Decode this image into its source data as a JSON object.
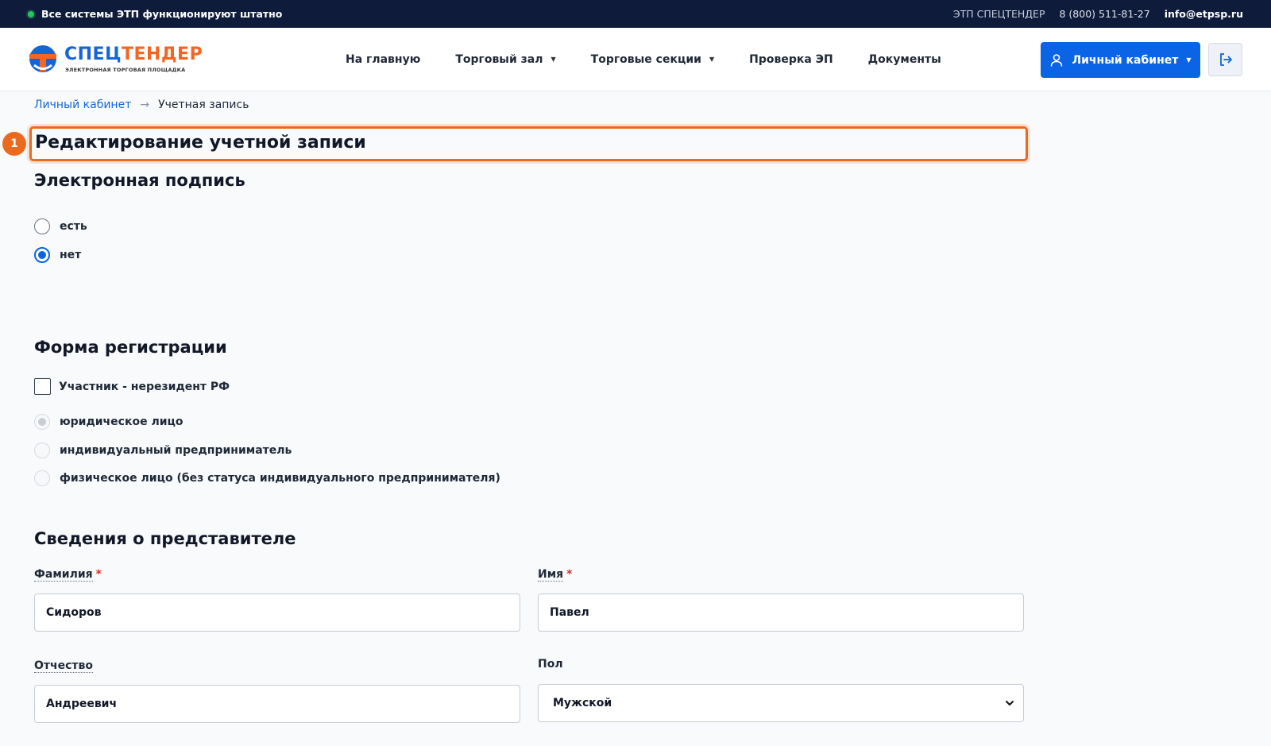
{
  "topbar": {
    "status": "Все системы ЭТП функционируют штатно",
    "platform": "ЭТП СПЕЦТЕНДЕР",
    "phone": "8 (800) 511-81-27",
    "email": "info@etpsp.ru"
  },
  "logo": {
    "part1": "СПЕЦ",
    "part2": "ТЕНДЕР",
    "tagline": "ЭЛЕКТРОННАЯ ТОРГОВАЯ ПЛОЩАДКА"
  },
  "nav": {
    "home": "На главную",
    "trading_hall": "Торговый зал",
    "trading_sections": "Торговые секции",
    "ep_check": "Проверка ЭП",
    "documents": "Документы"
  },
  "header": {
    "cabinet_label": "Личный кабинет"
  },
  "breadcrumb": {
    "root": "Личный кабинет",
    "arrow": "→",
    "current": "Учетная запись"
  },
  "page": {
    "badge": "1",
    "title": "Редактирование учетной записи"
  },
  "signature": {
    "heading": "Электронная подпись",
    "options": [
      "есть",
      "нет"
    ],
    "selected": "нет"
  },
  "registration": {
    "heading": "Форма регистрации",
    "nonresident_label": "Участник - нерезидент РФ",
    "options": [
      "юридическое лицо",
      "индивидуальный предприниматель",
      "физическое лицо (без статуса индивидуального предпринимателя)"
    ],
    "selected": "юридическое лицо"
  },
  "representative": {
    "heading": "Сведения о представителе",
    "required_mark": "*",
    "last_name_label": "Фамилия",
    "last_name_value": "Сидоров",
    "first_name_label": "Имя",
    "first_name_value": "Павел",
    "patronymic_label": "Отчество",
    "patronymic_value": "Андреевич",
    "gender_label": "Пол",
    "gender_value": "Мужской"
  },
  "colors": {
    "brand_blue": "#1565d8",
    "brand_orange": "#f26522",
    "primary_button": "#0b63e5",
    "highlight": "#ea6a1f",
    "topbar": "#0f1b3a"
  }
}
